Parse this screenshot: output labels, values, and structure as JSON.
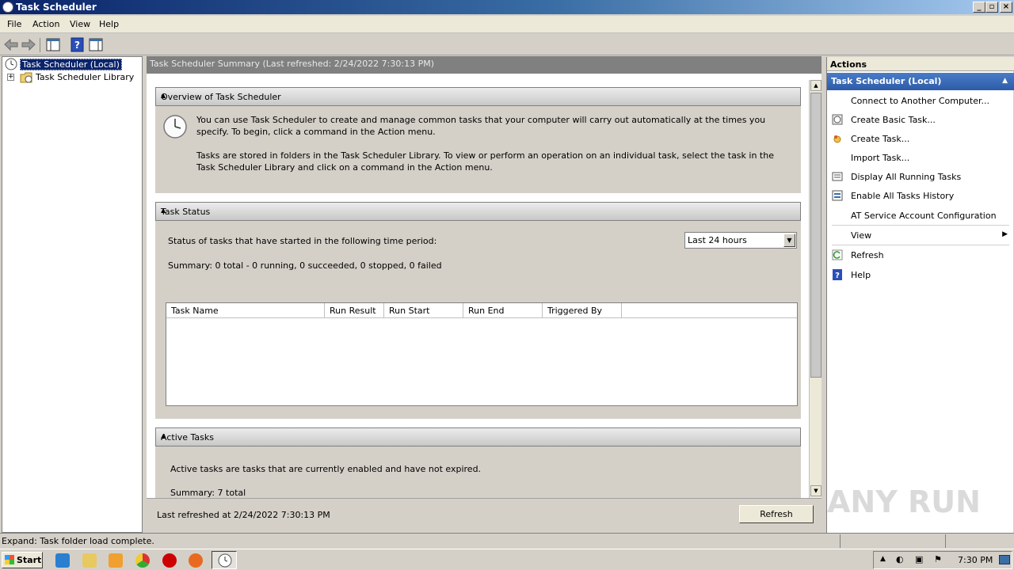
{
  "window": {
    "title": "Task Scheduler"
  },
  "menu": [
    "File",
    "Action",
    "View",
    "Help"
  ],
  "tree": {
    "root": "Task Scheduler (Local)",
    "child": "Task Scheduler Library"
  },
  "center": {
    "header": "Task Scheduler Summary (Last refreshed: 2/24/2022 7:30:13 PM)",
    "overview": {
      "title": "Overview of Task Scheduler",
      "p1": "You can use Task Scheduler to create and manage common tasks that your computer will carry out automatically at the times you specify. To begin, click a command in the Action menu.",
      "p2": "Tasks are stored in folders in the Task Scheduler Library. To view or perform an operation on an individual task, select the task in the Task Scheduler Library and click on a command in the Action menu."
    },
    "status": {
      "title": "Task Status",
      "period_label": "Status of tasks that have started in the following time period:",
      "period_value": "Last 24 hours",
      "summary": "Summary: 0 total - 0 running, 0 succeeded, 0 stopped, 0 failed",
      "columns": [
        "Task Name",
        "Run Result",
        "Run Start",
        "Run End",
        "Triggered By"
      ]
    },
    "active": {
      "title": "Active Tasks",
      "desc": "Active tasks are tasks that are currently enabled and have not expired.",
      "summary": "Summary: 7 total"
    },
    "footer_text": "Last refreshed at 2/24/2022 7:30:13 PM",
    "refresh_button": "Refresh"
  },
  "actions": {
    "title": "Actions",
    "group": "Task Scheduler (Local)",
    "items": [
      "Connect to Another Computer...",
      "Create Basic Task...",
      "Create Task...",
      "Import Task...",
      "Display All Running Tasks",
      "Enable All Tasks History",
      "AT Service Account Configuration",
      "View",
      "Refresh",
      "Help"
    ]
  },
  "statusbar": {
    "text": "Expand:  Task folder load complete."
  },
  "taskbar": {
    "start": "Start",
    "clock": "7:30 PM"
  },
  "watermark": "ANY RUN"
}
